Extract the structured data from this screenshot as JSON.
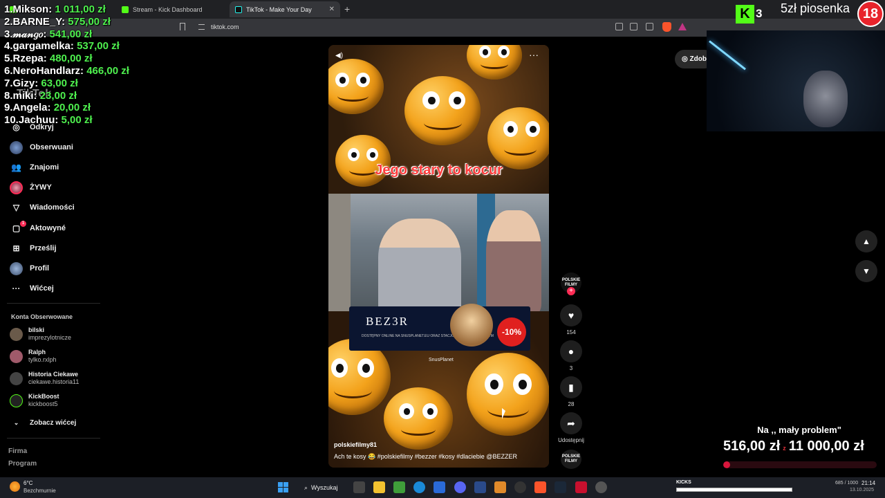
{
  "browser": {
    "tabs": [
      {
        "label": "",
        "icon": "kick-icon"
      },
      {
        "label": "Stream - Kick Dashboard",
        "icon": "kick-icon"
      },
      {
        "label": "TikTok - Make Your Day",
        "icon": "tiktok-icon",
        "close": "✕"
      }
    ],
    "new_tab": "+",
    "url": "tiktok.com"
  },
  "leaderboard": [
    {
      "rank": "1.",
      "name": "Mikson:",
      "amount": "1 011,00 zł"
    },
    {
      "rank": "2.",
      "name": "BARNE_Y:",
      "amount": "575,00 zł"
    },
    {
      "rank": "3.",
      "name": "𝓂𝒶𝓃𝑔𝑜:",
      "amount": "541,00 zł"
    },
    {
      "rank": "4.",
      "name": "gargamelka:",
      "amount": "537,00 zł"
    },
    {
      "rank": "5.",
      "name": "Rzepa:",
      "amount": "480,00 zł"
    },
    {
      "rank": "6.",
      "name": "NeroHandlarz:",
      "amount": "466,00 zł"
    },
    {
      "rank": "7.",
      "name": "Gizy:",
      "amount": "63,00 zł"
    },
    {
      "rank": "8.",
      "name": "miki:",
      "amount": "23,00 zł"
    },
    {
      "rank": "9.",
      "name": "Angela:",
      "amount": "20,00 zł"
    },
    {
      "rank": "10.",
      "name": "Jachuu:",
      "amount": "5,00 zł"
    }
  ],
  "tiktok_logo": "TikTok",
  "sidebar": {
    "items": [
      {
        "label": "Odkryj",
        "icon": "compass-icon"
      },
      {
        "label": "Obserwuani",
        "icon": "following-avatar-icon"
      },
      {
        "label": "Znajomi",
        "icon": "friends-icon"
      },
      {
        "label": "ŻYWY",
        "icon": "live-icon"
      },
      {
        "label": "Wiadomości",
        "icon": "messages-icon"
      },
      {
        "label": "Aktowyné",
        "icon": "activity-icon",
        "badge": "1"
      },
      {
        "label": "Prześlij",
        "icon": "upload-icon"
      },
      {
        "label": "Profil",
        "icon": "profile-icon"
      },
      {
        "label": "Wićcej",
        "icon": "more-icon"
      }
    ],
    "following_heading": "Konta Obserwowane",
    "following": [
      {
        "name": "bilski",
        "handle": "imprezylotnicze"
      },
      {
        "name": "Ralph",
        "handle": "tylko.rxlph"
      },
      {
        "name": "Historia Ciekawe",
        "handle": "ciekawe.historia11"
      },
      {
        "name": "KickBoost",
        "handle": "kickboost5"
      }
    ],
    "see_more": "Zobacz wićcej",
    "footer_links": [
      "Firma",
      "Program"
    ]
  },
  "video": {
    "caption": "Jego stary to kocur",
    "ad_brand": "BEZ3R",
    "ad_sub": "DOSTĘPNY ONLINE NA SNUSPLANET.EU\nORAZ STACJONARNIE W SIECI E-DYM",
    "ad_discount": "-10%",
    "ad_sponsor": "SnusPlanet",
    "username": "polskiefilmy81",
    "description": "Ach te kosy 😂 #polskiefilmy #bezzer #kosy #dlaciebie @BEZZER"
  },
  "actions": {
    "creator_avatar": "POLSKIE FILMY",
    "follow_plus": "+",
    "likes": "154",
    "comments": "3",
    "saves": "28",
    "share_label": "Udostępnij",
    "music_label": "POLSKIE FILMY"
  },
  "coins_button": "Zdobą",
  "stream_overlay": {
    "kick_count": "3",
    "song_label": "5zł piosenka",
    "age_badge": "18",
    "goal_title": "Na ,, mały problem\"",
    "goal_current": "516,00 zł",
    "goal_separator": "z",
    "goal_target": "11 000,00 zł",
    "goal_progress": 0.047
  },
  "taskbar": {
    "weather_temp": "6°C",
    "weather_desc": "Bezchmurnie",
    "search_label": "Wyszukaj",
    "kicks_label": "KICKS",
    "kicks_count": "685 / 1000",
    "time": "21:14",
    "date": "13.10.2025"
  },
  "colors": {
    "leaderboard_amount": "#4ef04e",
    "tiktok_accent": "#fe2c55",
    "kick_green": "#53fc18",
    "goal_red": "#d8163c"
  }
}
